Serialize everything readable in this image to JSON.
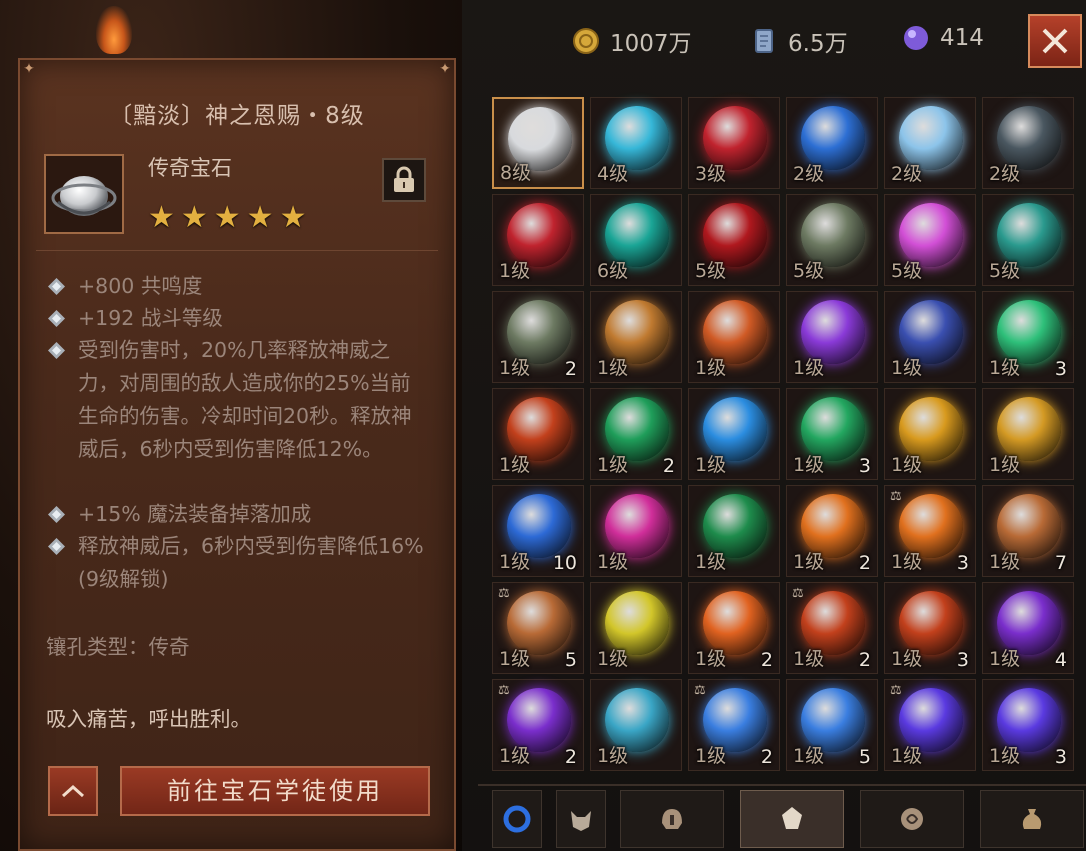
{
  "currency": [
    {
      "icon": "gold-coin-icon",
      "value": "1007万",
      "color": "#d6a83a"
    },
    {
      "icon": "platinum-card-icon",
      "value": "6.5万",
      "color": "#8fa7c9"
    },
    {
      "icon": "purple-orb-icon",
      "value": "414",
      "color": "#7e5bd9"
    }
  ],
  "detail": {
    "title": "〔黯淡〕神之恩赐・8级",
    "type": "传奇宝石",
    "stars": "★★★★★",
    "attributes": [
      "+800 共鸣度",
      "+192 战斗等级",
      "受到伤害时，20%几率释放神威之力，对周围的敌人造成你的25%当前生命的伤害。冷却时间20秒。释放神威后，6秒内受到伤害降低12%。",
      "+15% 魔法装备掉落加成",
      "释放神威后，6秒内受到伤害降低16%(9级解锁)"
    ],
    "socket": "镶孔类型：传奇",
    "flavor": "吸入痛苦，呼出胜利。",
    "button": "前往宝石学徒使用"
  },
  "gems": [
    {
      "icon": "silver-ring-gem-icon",
      "level": "8级",
      "count": "",
      "locked": false,
      "color": "#d8dadd"
    },
    {
      "icon": "cyan-crystal-gem-icon",
      "level": "4级",
      "count": "",
      "locked": false,
      "color": "#36b7d8"
    },
    {
      "icon": "red-crystal-gem-icon",
      "level": "3级",
      "count": "",
      "locked": false,
      "color": "#c0232e"
    },
    {
      "icon": "blue-shard-gem-icon",
      "level": "2级",
      "count": "",
      "locked": false,
      "color": "#2d6fd4"
    },
    {
      "icon": "ice-orb-gem-icon",
      "level": "2级",
      "count": "",
      "locked": false,
      "color": "#8cc4ea"
    },
    {
      "icon": "dark-orb-gem-icon",
      "level": "2级",
      "count": "",
      "locked": false,
      "color": "#4a5760"
    },
    {
      "icon": "red-crystal-gem-icon",
      "level": "1级",
      "count": "",
      "locked": false,
      "color": "#c0232e"
    },
    {
      "icon": "teal-orb-gem-icon",
      "level": "6级",
      "count": "",
      "locked": false,
      "color": "#1aa596"
    },
    {
      "icon": "blood-crest-gem-icon",
      "level": "5级",
      "count": "",
      "locked": false,
      "color": "#b0181e"
    },
    {
      "icon": "serpent-eye-gem-icon",
      "level": "5级",
      "count": "",
      "locked": false,
      "color": "#6d7a62"
    },
    {
      "icon": "pink-orb-gem-icon",
      "level": "5级",
      "count": "",
      "locked": false,
      "color": "#d24fd6"
    },
    {
      "icon": "teal-swirl-gem-icon",
      "level": "5级",
      "count": "",
      "locked": false,
      "color": "#2a9a8e"
    },
    {
      "icon": "serpent-eye-gem-icon",
      "level": "1级",
      "count": "2",
      "locked": false,
      "color": "#6d7a62"
    },
    {
      "icon": "amber-orb-gem-icon",
      "level": "1级",
      "count": "",
      "locked": false,
      "color": "#c07a30"
    },
    {
      "icon": "fire-heart-gem-icon",
      "level": "1级",
      "count": "",
      "locked": false,
      "color": "#d05a25"
    },
    {
      "icon": "violet-orb-gem-icon",
      "level": "1级",
      "count": "",
      "locked": false,
      "color": "#8a3ad8"
    },
    {
      "icon": "blue-cluster-gem-icon",
      "level": "1级",
      "count": "",
      "locked": false,
      "color": "#3a4fb0"
    },
    {
      "icon": "green-wing-gem-icon",
      "level": "1级",
      "count": "3",
      "locked": false,
      "color": "#2ec07a"
    },
    {
      "icon": "lava-gem-icon",
      "level": "1级",
      "count": "",
      "locked": false,
      "color": "#c2401c"
    },
    {
      "icon": "green-shard-gem-icon",
      "level": "1级",
      "count": "2",
      "locked": false,
      "color": "#1f9e5a"
    },
    {
      "icon": "blue-rune-gem-icon",
      "level": "1级",
      "count": "",
      "locked": false,
      "color": "#2b8de0"
    },
    {
      "icon": "jade-swirl-gem-icon",
      "level": "1级",
      "count": "3",
      "locked": false,
      "color": "#23a760"
    },
    {
      "icon": "gold-shard-gem-icon",
      "level": "1级",
      "count": "",
      "locked": false,
      "color": "#d89a1e"
    },
    {
      "icon": "gold-crest-gem-icon",
      "level": "1级",
      "count": "",
      "locked": false,
      "color": "#d49a24"
    },
    {
      "icon": "blue-swirl-gem-icon",
      "level": "1级",
      "count": "10",
      "locked": false,
      "color": "#2d6ad6"
    },
    {
      "icon": "magenta-crystal-gem-icon",
      "level": "1级",
      "count": "",
      "locked": false,
      "color": "#d02e9a"
    },
    {
      "icon": "green-rune-gem-icon",
      "level": "1级",
      "count": "",
      "locked": false,
      "color": "#1e8c4c"
    },
    {
      "icon": "orange-tree-gem-icon",
      "level": "1级",
      "count": "2",
      "locked": false,
      "color": "#e0701e"
    },
    {
      "icon": "orange-tree-gem-icon",
      "level": "1级",
      "count": "3",
      "locked": true,
      "color": "#e0701e"
    },
    {
      "icon": "bronze-knot-gem-icon",
      "level": "1级",
      "count": "7",
      "locked": false,
      "color": "#b86a36"
    },
    {
      "icon": "bronze-knot-gem-icon",
      "level": "1级",
      "count": "5",
      "locked": true,
      "color": "#b86a36"
    },
    {
      "icon": "yellow-cube-gem-icon",
      "level": "1级",
      "count": "",
      "locked": false,
      "color": "#d2c62a"
    },
    {
      "icon": "magma-orb-gem-icon",
      "level": "1级",
      "count": "2",
      "locked": false,
      "color": "#e06220"
    },
    {
      "icon": "lava-gem-icon",
      "level": "1级",
      "count": "2",
      "locked": true,
      "color": "#c2401c"
    },
    {
      "icon": "lava-gem-icon",
      "level": "1级",
      "count": "3",
      "locked": false,
      "color": "#c2401c"
    },
    {
      "icon": "violet-shard-gem-icon",
      "level": "1级",
      "count": "4",
      "locked": false,
      "color": "#7a2ecc"
    },
    {
      "icon": "violet-shard-gem-icon",
      "level": "1级",
      "count": "2",
      "locked": true,
      "color": "#7a2ecc"
    },
    {
      "icon": "aqua-orb-gem-icon",
      "level": "1级",
      "count": "",
      "locked": false,
      "color": "#3aa6c6"
    },
    {
      "icon": "blue-drop-gem-icon",
      "level": "1级",
      "count": "2",
      "locked": true,
      "color": "#3a7ee0"
    },
    {
      "icon": "blue-drop-gem-icon",
      "level": "1级",
      "count": "5",
      "locked": false,
      "color": "#3a7ee0"
    },
    {
      "icon": "indigo-orb-gem-icon",
      "level": "1级",
      "count": "",
      "locked": true,
      "color": "#5a3ae0"
    },
    {
      "icon": "indigo-orb-gem-icon",
      "level": "1级",
      "count": "3",
      "locked": false,
      "color": "#5a3ae0"
    }
  ],
  "tabs": [
    {
      "icon": "blue-ring-icon",
      "active": false
    },
    {
      "icon": "demon-mask-icon",
      "active": false
    },
    {
      "icon": "helmet-icon",
      "active": false
    },
    {
      "icon": "gem-tab-icon",
      "active": true
    },
    {
      "icon": "rune-swirl-icon",
      "active": false
    },
    {
      "icon": "loot-bag-icon",
      "active": false
    }
  ]
}
